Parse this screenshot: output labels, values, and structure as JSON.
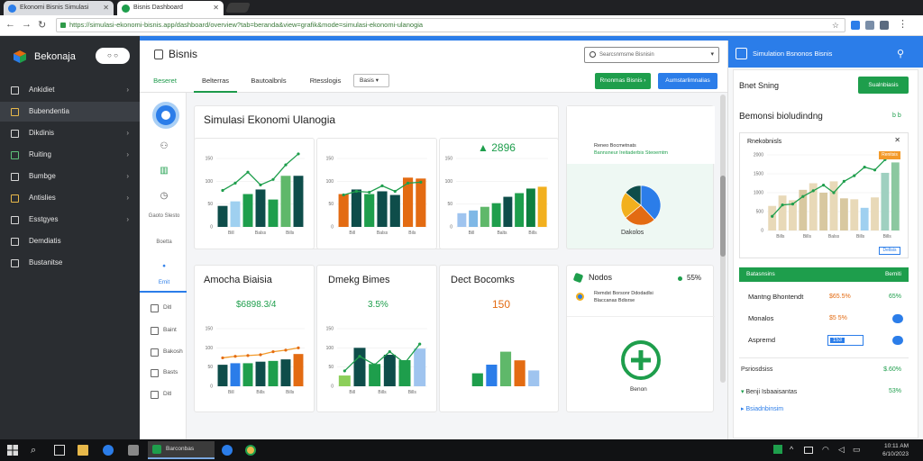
{
  "browser": {
    "tabs": [
      {
        "label": "Ekonomi Bisnis Simulasi",
        "icon_color": "#2b7de9"
      },
      {
        "label": "Bisnis Dashboard",
        "icon_color": "#1e9e4c"
      }
    ],
    "url": "https://simulasi-ekonomi-bisnis.app/dashboard/overview?tab=beranda&view=grafik&mode=simulasi-ekonomi-ulanogia",
    "colors": {
      "accent": "#2b7de9",
      "green": "#1e9e4c",
      "orange": "#e36b12",
      "dark": "#2a2d31"
    }
  },
  "sidebar": {
    "brand": "Bekonaja",
    "toggle": "○ ○",
    "items": [
      {
        "label": "Ankidiet",
        "icon": "dashboard-icon"
      },
      {
        "label": "Bubendentia",
        "icon": "folder-icon"
      },
      {
        "label": "Dikdinis",
        "icon": "document-icon"
      },
      {
        "label": "Ruiting",
        "icon": "chart-icon"
      },
      {
        "label": "Bumbge",
        "icon": "data-icon"
      },
      {
        "label": "Antislies",
        "icon": "list-icon"
      },
      {
        "label": "Esstgyes",
        "icon": "settings-icon"
      },
      {
        "label": "Demdiatis",
        "icon": "users-icon"
      },
      {
        "label": "Bustanitse",
        "icon": "book-icon"
      }
    ]
  },
  "main": {
    "title": "Bisnis",
    "search_placeholder": "Searcsnmsme Bisnisin",
    "tabs": [
      "Beseret",
      "Belterras",
      "Bautoalbnls",
      "Rtesslogis"
    ],
    "select_value": "Basis",
    "btn_green": "Rnonmas Bisnis",
    "btn_blue": "Aumstarlimnalias",
    "rail": {
      "labels": [
        "Gaoto Slesto",
        "Boetta"
      ],
      "active_label": "Ernit",
      "rows": [
        "Ditl",
        "Baint",
        "Bakosh",
        "Basts",
        "Ditl"
      ]
    },
    "cards": {
      "big_title": "Simulasi Ekonomi Ulanogia",
      "top_metric": "2896",
      "mid_title_1": "Amocha Biaisia",
      "mid_metric_1": "$6898.3/4",
      "mid_title_2": "Dmekg Bimes",
      "mid_metric_2": "3.5%",
      "mid_title_3": "Dect Bocomks",
      "mid_metric_3": "150",
      "legend_text_1": "Reneo Bocmetnats",
      "legend_text_2": "Bannsneur Ireitaderbis Steoemtm",
      "pie_label": "Dakolos",
      "mid_title_4": "Nodos",
      "mid_metric_4": "55%",
      "legend_text_3": "Remdst Borsonr Ddodadlsi",
      "legend_text_4": "Blaccanas Bdisrse",
      "add_label": "Benon"
    }
  },
  "right_panel": {
    "header": "Simulation Bsnonos Bisnis",
    "label_1": "Bnet Sning",
    "button": "Sualnbiasis",
    "label_2": "Bemonsi bioludindng",
    "link": "b b",
    "chart_title": "Rnekobnisls",
    "chart_badge": "Renitsis",
    "chart_badge_2": "Deltsis",
    "table_head_left": "Batasnsins",
    "table_head_right": "Bemiti",
    "rows": [
      {
        "label": "Mantng Bhontendt",
        "value": "$65.5%",
        "pct": "65%"
      },
      {
        "label": "Monalos",
        "value": "$5 5%",
        "pct": ""
      },
      {
        "label": "Aspremd",
        "value": "153",
        "pct": ""
      }
    ],
    "list": [
      {
        "label": "Psriosdsiss",
        "pct": "$.60%"
      },
      {
        "label": "Benji Isbaaisantas",
        "pct": "53%"
      },
      {
        "label": "Bsiadnbinsim",
        "pct": ""
      }
    ]
  },
  "taskbar": {
    "app": "Barconbas",
    "time": "10:11 AM",
    "date": "6/10/2023"
  },
  "chart_data": [
    {
      "type": "bar",
      "name_hint": "card-1-bars",
      "categories": [
        "1",
        "2",
        "3",
        "4",
        "5",
        "6",
        "7"
      ],
      "values": [
        46,
        56,
        72,
        82,
        60,
        112,
        112
      ],
      "ylim": [
        0,
        150
      ],
      "yticks": [
        "0",
        "50",
        "100",
        "150"
      ],
      "xticks": [
        "Bill",
        "Balss",
        "Bills"
      ],
      "line": [
        80,
        96,
        120,
        92,
        104,
        136,
        160
      ]
    },
    {
      "type": "bar",
      "name_hint": "card-2-bars",
      "categories": [
        "1",
        "2",
        "3",
        "4",
        "5",
        "6",
        "7"
      ],
      "values": [
        72,
        82,
        72,
        78,
        70,
        108,
        106
      ],
      "ylim": [
        0,
        150
      ],
      "yticks": [
        "0",
        "50",
        "100",
        "150"
      ],
      "xticks": [
        "Bill",
        "Balss",
        "Bils"
      ],
      "line": [
        70,
        78,
        76,
        90,
        78,
        96,
        98
      ]
    },
    {
      "type": "bar",
      "name_hint": "card-3-bars",
      "categories": [
        "1",
        "2",
        "3",
        "4",
        "5",
        "6",
        "7",
        "8"
      ],
      "values": [
        30,
        36,
        44,
        52,
        66,
        74,
        84,
        88
      ],
      "ylim": [
        0,
        150
      ],
      "yticks": [
        "0",
        "50",
        "100",
        "150"
      ],
      "xticks": [
        "Bill",
        "Balts",
        "Bills"
      ]
    },
    {
      "type": "bar",
      "name_hint": "card-4-bars",
      "categories": [
        "1",
        "2",
        "3",
        "4",
        "5",
        "6",
        "7"
      ],
      "values": [
        56,
        60,
        60,
        64,
        66,
        70,
        84
      ],
      "ylim": [
        0,
        150
      ],
      "yticks": [
        "0",
        "50",
        "100",
        "150"
      ],
      "xticks": [
        "Bill",
        "Bills",
        "Bills"
      ],
      "line": [
        74,
        78,
        80,
        82,
        90,
        94,
        100
      ]
    },
    {
      "type": "bar",
      "name_hint": "card-5-bars",
      "categories": [
        "1",
        "2",
        "3",
        "4",
        "5",
        "6"
      ],
      "values": [
        28,
        100,
        58,
        82,
        68,
        98
      ],
      "ylim": [
        0,
        150
      ],
      "yticks": [
        "0",
        "50",
        "100",
        "150"
      ],
      "xticks": [
        "Bill",
        "Bills",
        "Bills"
      ],
      "line": [
        40,
        78,
        56,
        90,
        60,
        110
      ]
    },
    {
      "type": "bar",
      "name_hint": "card-6-bars",
      "categories": [
        "1",
        "2",
        "3",
        "4",
        "5"
      ],
      "values": [
        18,
        30,
        48,
        36,
        22
      ],
      "ylim": [
        0,
        80
      ]
    },
    {
      "type": "pie",
      "name_hint": "card-pie",
      "values": [
        38,
        26,
        22,
        14
      ]
    },
    {
      "type": "bar",
      "name_hint": "right-panel-bars",
      "categories": [
        "1",
        "2",
        "3",
        "4",
        "5",
        "6",
        "7",
        "8",
        "9",
        "10",
        "11",
        "12",
        "13"
      ],
      "values": [
        52,
        74,
        64,
        86,
        100,
        80,
        104,
        68,
        66,
        48,
        70,
        122,
        144
      ],
      "ylim": [
        0,
        160
      ],
      "yticks": [
        "0",
        "500",
        "1000",
        "1500",
        "2000"
      ],
      "xticks": [
        "Bills",
        "Bills",
        "Balss",
        "Bills",
        "Bills"
      ],
      "line": [
        30,
        54,
        56,
        72,
        84,
        96,
        80,
        104,
        116,
        134,
        128,
        150,
        162
      ]
    }
  ]
}
